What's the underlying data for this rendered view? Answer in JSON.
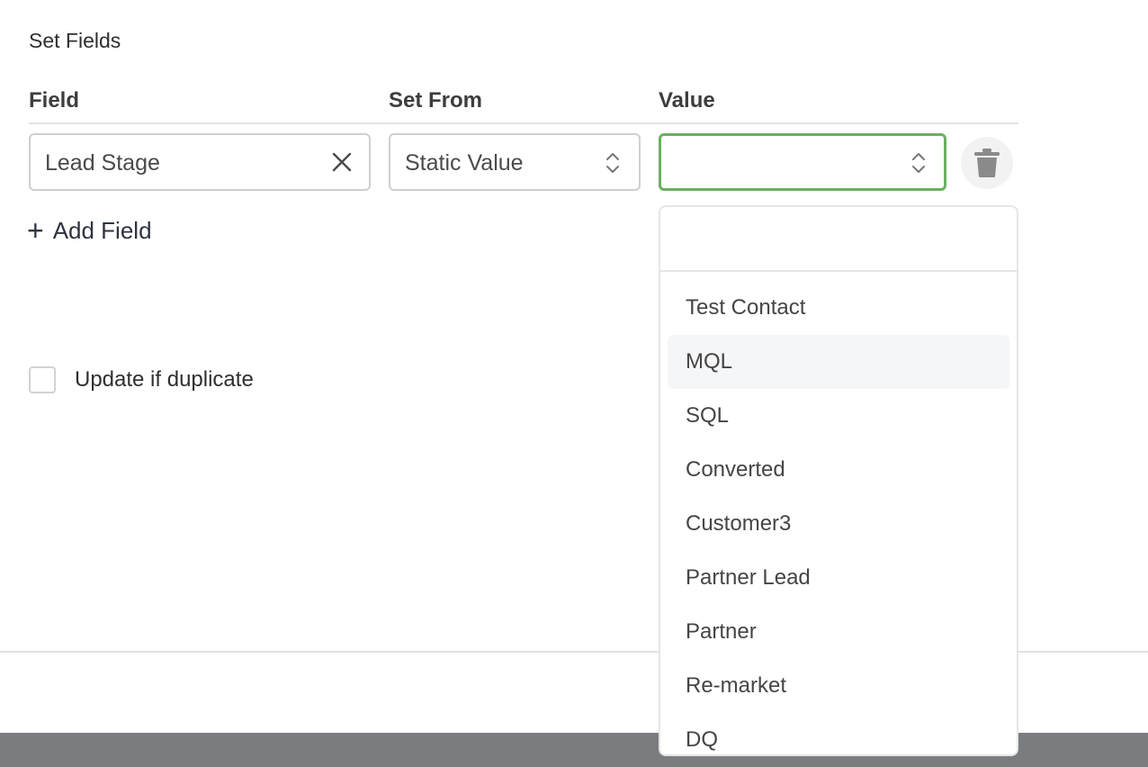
{
  "section_title": "Set Fields",
  "columns": {
    "field": "Field",
    "set_from": "Set From",
    "value": "Value"
  },
  "row": {
    "field_value": "Lead Stage",
    "set_from_value": "Static Value",
    "value_value": ""
  },
  "add_field_label": "Add Field",
  "update_duplicate_label": "Update if duplicate",
  "update_duplicate_checked": false,
  "dropdown": {
    "search_value": "",
    "options": [
      "Test Contact",
      "MQL",
      "SQL",
      "Converted",
      "Customer3",
      "Partner Lead",
      "Partner",
      "Re-market",
      "DQ"
    ],
    "highlighted": "MQL"
  },
  "colors": {
    "focus_border": "#6ab160",
    "footer_bar": "#7b7c7f",
    "highlight": "#f5f6f8"
  },
  "icons": {
    "clear": "close-icon",
    "select": "chevron-up-down-icon",
    "delete": "trash-icon",
    "add": "plus-icon"
  }
}
